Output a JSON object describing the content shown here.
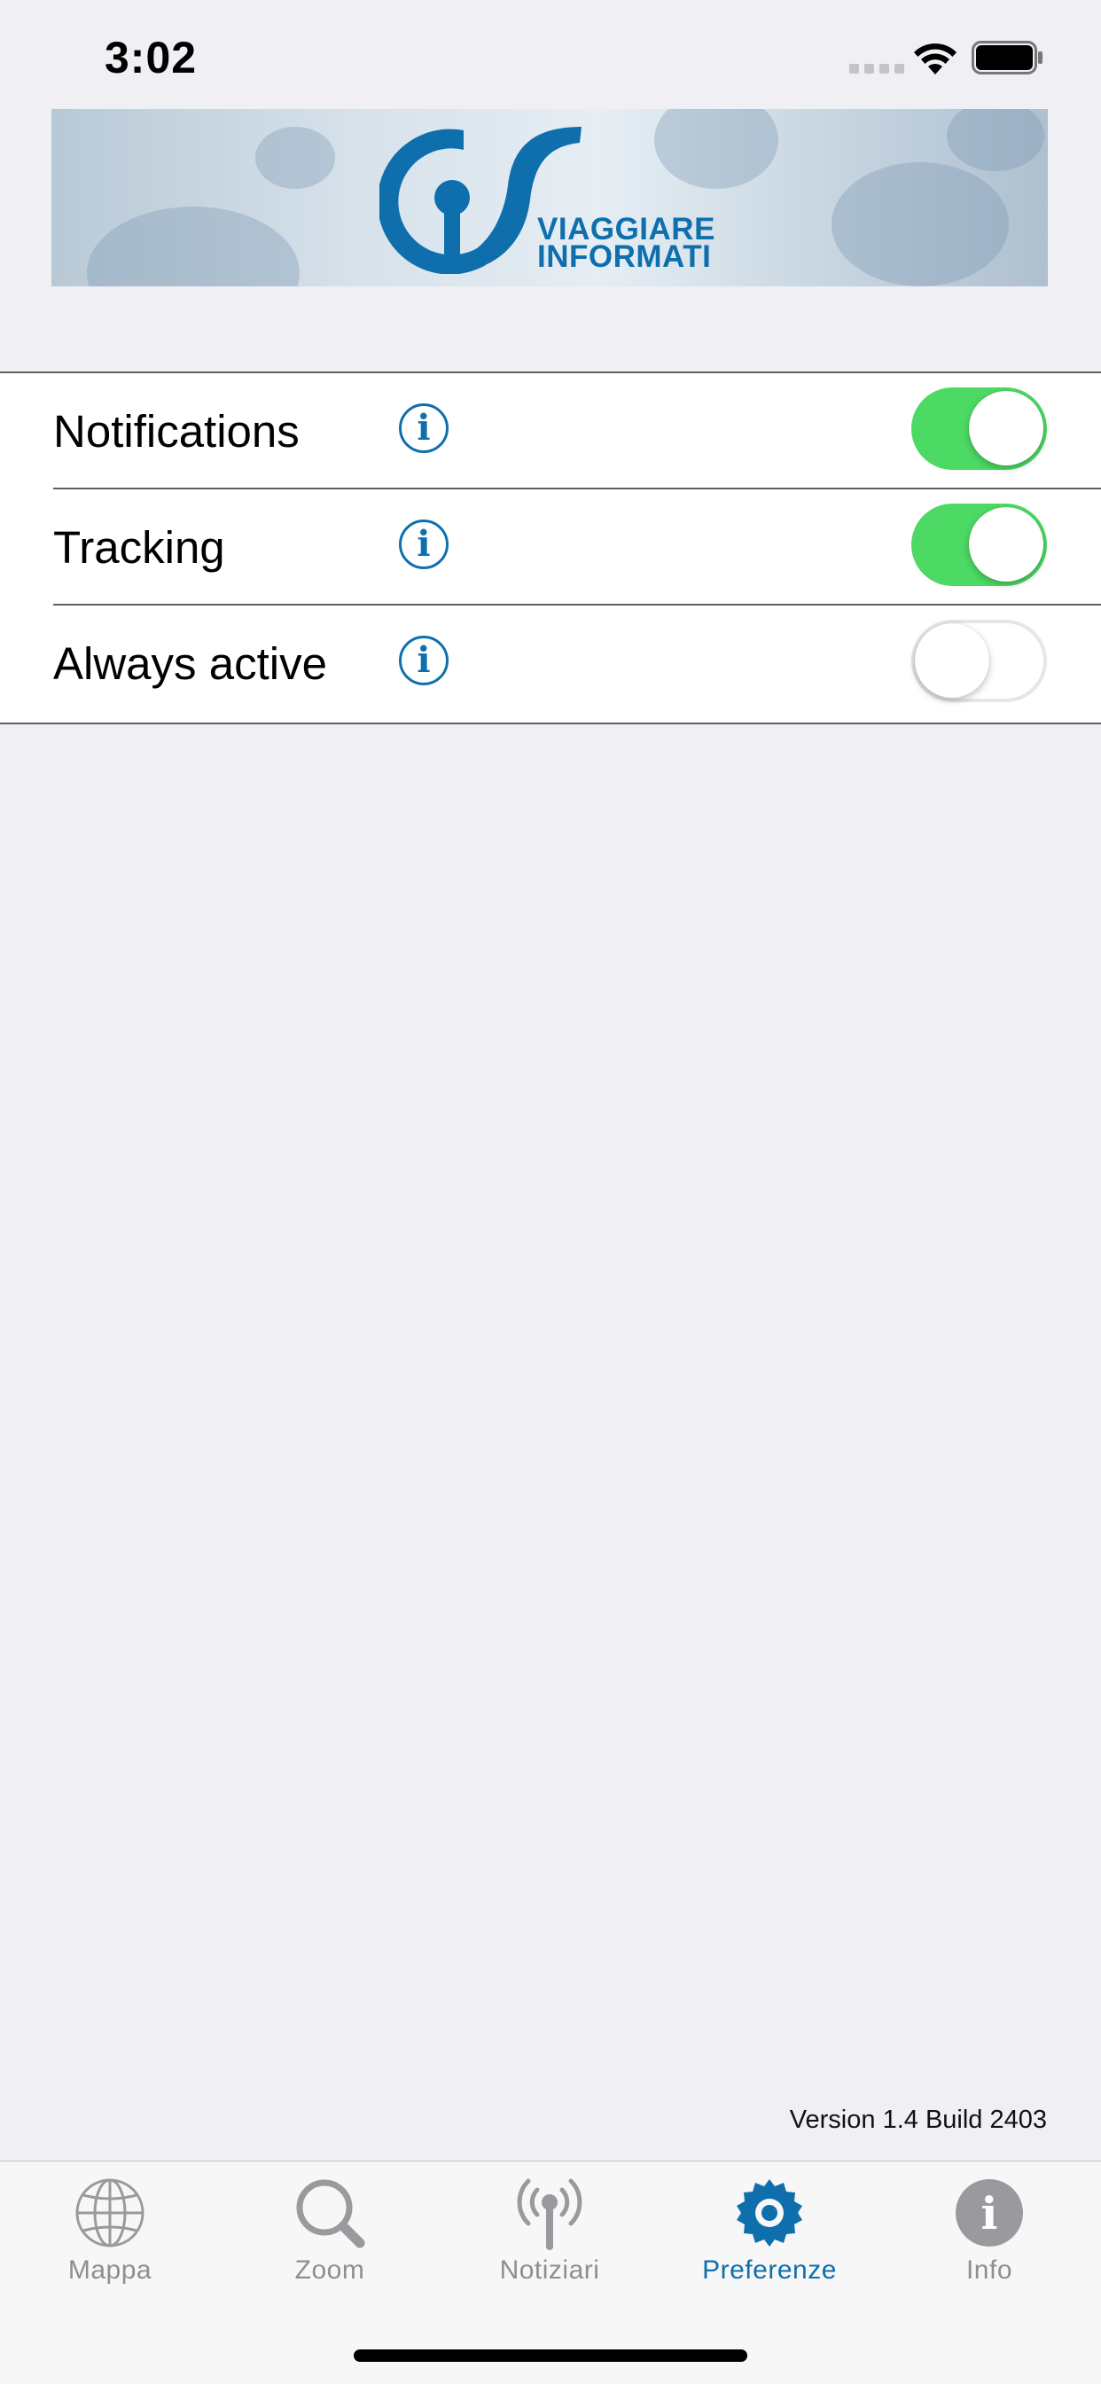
{
  "status_bar": {
    "time": "3:02",
    "wifi_icon": "wifi-icon",
    "battery_icon": "battery-icon"
  },
  "banner": {
    "logo_icon": "cis-logo",
    "line1": "VIAGGIARE",
    "line2": "INFORMATI"
  },
  "settings": [
    {
      "label": "Notifications",
      "enabled": true,
      "info_icon": "info-icon"
    },
    {
      "label": "Tracking",
      "enabled": true,
      "info_icon": "info-icon"
    },
    {
      "label": "Always active",
      "enabled": false,
      "info_icon": "info-icon"
    }
  ],
  "info_glyph": "i",
  "version": "Version 1.4 Build 2403",
  "tab_bar": {
    "active_tab": "Preferenze",
    "active_color": "#0f6fad",
    "inactive_color": "#8e8e93",
    "tabs": [
      {
        "label": "Mappa",
        "icon": "globe-icon"
      },
      {
        "label": "Zoom",
        "icon": "magnifier-icon"
      },
      {
        "label": "Notiziari",
        "icon": "broadcast-icon"
      },
      {
        "label": "Preferenze",
        "icon": "gear-icon"
      },
      {
        "label": "Info",
        "icon": "info-circle-icon"
      }
    ]
  },
  "colors": {
    "toggle_on": "#4cd964",
    "accent": "#0f6fad",
    "background": "#efeff4"
  }
}
